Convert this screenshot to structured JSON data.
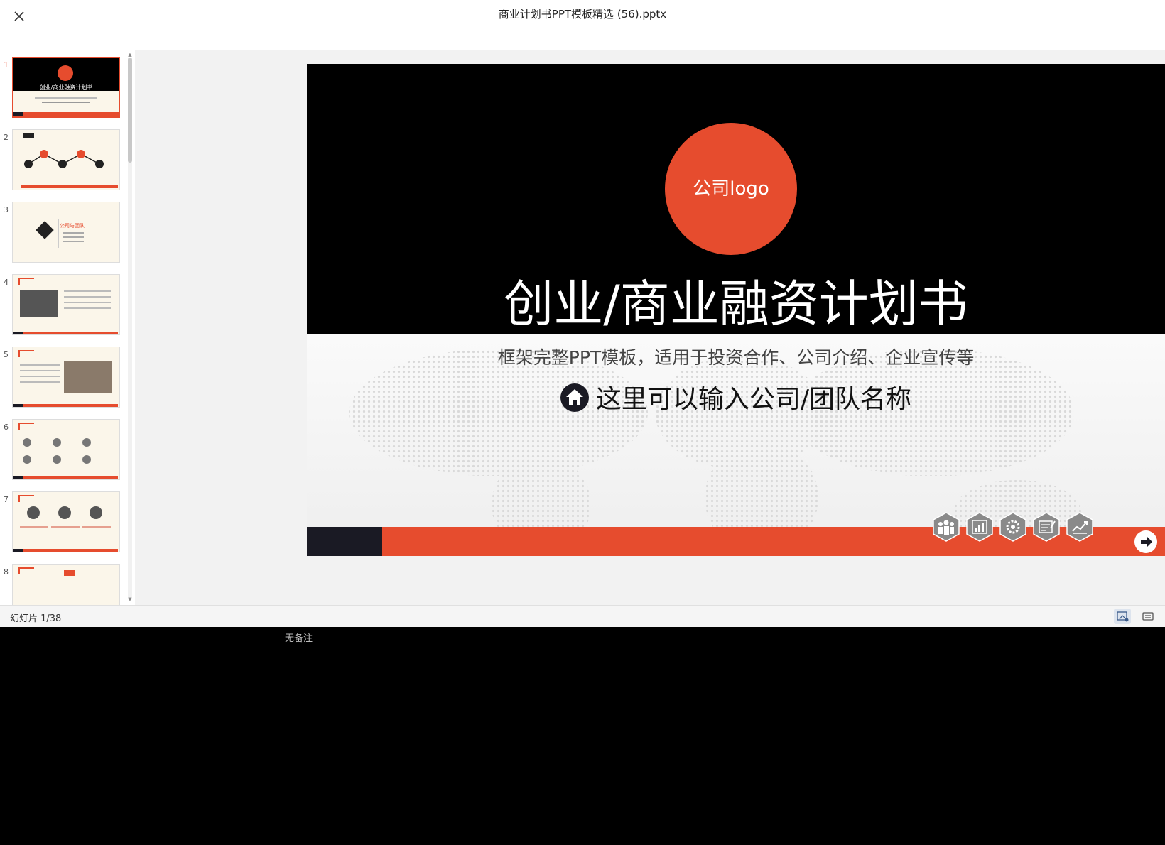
{
  "window": {
    "title": "商业计划书PPT模板精选 (56).pptx"
  },
  "thumbnails": [
    {
      "number": "1",
      "active": true
    },
    {
      "number": "2",
      "active": false
    },
    {
      "number": "3",
      "active": false
    },
    {
      "number": "4",
      "active": false
    },
    {
      "number": "5",
      "active": false
    },
    {
      "number": "6",
      "active": false
    },
    {
      "number": "7",
      "active": false
    },
    {
      "number": "8",
      "active": false
    }
  ],
  "thumb_texts": {
    "t1_title": "创业/商业融资计划书",
    "t3_title": "公司与团队"
  },
  "slide": {
    "logo_text": "公司logo",
    "title": "创业/商业融资计划书",
    "subtitle": "框架完整PPT模板，适用于投资合作、公司介绍、企业宣传等",
    "team_line": "这里可以输入公司/团队名称",
    "icons": [
      "team-icon",
      "chart-icon",
      "gear-icon",
      "document-icon",
      "growth-icon"
    ]
  },
  "notes": {
    "empty_label": "无备注"
  },
  "status": {
    "slide_counter": "幻灯片 1/38"
  },
  "colors": {
    "accent": "#e64c2e",
    "dark": "#1a1a24"
  }
}
